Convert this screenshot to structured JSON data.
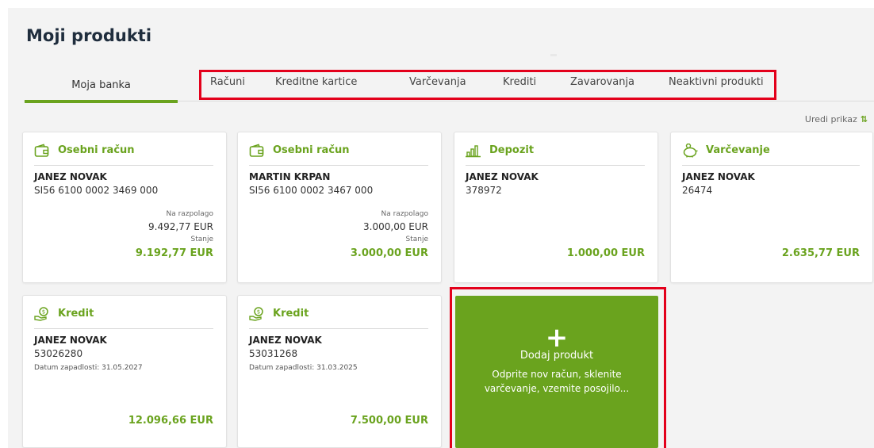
{
  "page": {
    "title": "Moji produkti"
  },
  "tabs": {
    "active": "Moja banka",
    "items": [
      "Računi",
      "Kreditne kartice",
      "Varčevanja",
      "Krediti",
      "Zavarovanja",
      "Neaktivni produkti"
    ]
  },
  "edit_view": {
    "label": "Uredi prikaz",
    "icon": "sort-icon"
  },
  "cards": [
    {
      "type": "Osebni račun",
      "icon": "wallet-icon",
      "owner": "JANEZ NOVAK",
      "number": "SI56 6100 0002 3469 000",
      "available_label": "Na razpolago",
      "available": "9.492,77 EUR",
      "balance_label": "Stanje",
      "balance": "9.192,77 EUR"
    },
    {
      "type": "Osebni račun",
      "icon": "wallet-icon",
      "owner": "MARTIN KRPAN",
      "number": "SI56 6100 0002 3467 000",
      "available_label": "Na razpolago",
      "available": "3.000,00 EUR",
      "balance_label": "Stanje",
      "balance": "3.000,00 EUR"
    },
    {
      "type": "Depozit",
      "icon": "bar-chart-icon",
      "owner": "JANEZ NOVAK",
      "number": "378972",
      "balance": "1.000,00 EUR"
    },
    {
      "type": "Varčevanje",
      "icon": "piggy-bank-icon",
      "owner": "JANEZ NOVAK",
      "number": "26474",
      "balance": "2.635,77 EUR"
    },
    {
      "type": "Kredit",
      "icon": "money-hand-icon",
      "owner": "JANEZ NOVAK",
      "number": "53026280",
      "due_date": "Datum zapadlosti: 31.05.2027",
      "balance": "12.096,66 EUR"
    },
    {
      "type": "Kredit",
      "icon": "money-hand-icon",
      "owner": "JANEZ NOVAK",
      "number": "53031268",
      "due_date": "Datum zapadlosti: 31.03.2025",
      "balance": "7.500,00 EUR"
    }
  ],
  "add_product": {
    "icon": "plus-icon",
    "title": "Dodaj produkt",
    "description": "Odprite nov račun, sklenite varčevanje, vzemite posojilo..."
  },
  "colors": {
    "accent": "#6aa31e",
    "highlight": "#e3001b"
  }
}
